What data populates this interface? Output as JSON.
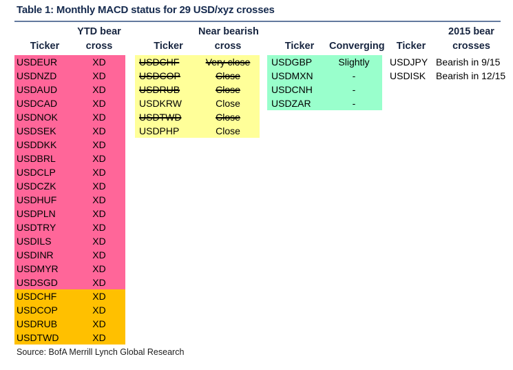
{
  "title": "Table 1: Monthly MACD status for 29 USD/xyz crosses",
  "source": "Source: BofA Merrill Lynch Global Research",
  "colors": {
    "pink": "#ff6699",
    "orange": "#ffc000",
    "yellow": "#ffff99",
    "green": "#99ffcc",
    "title_text": "#152a4e",
    "rule": "#63799e"
  },
  "columns": [
    {
      "id": "ytd-bear-cross",
      "header_line1": "YTD bear",
      "header_line2": "cross",
      "ticker_header": "Ticker",
      "rows": [
        {
          "ticker": "USDEUR",
          "value": "XD",
          "fill": "pink",
          "strike": false
        },
        {
          "ticker": "USDNZD",
          "value": "XD",
          "fill": "pink",
          "strike": false
        },
        {
          "ticker": "USDAUD",
          "value": "XD",
          "fill": "pink",
          "strike": false
        },
        {
          "ticker": "USDCAD",
          "value": "XD",
          "fill": "pink",
          "strike": false
        },
        {
          "ticker": "USDNOK",
          "value": "XD",
          "fill": "pink",
          "strike": false
        },
        {
          "ticker": "USDSEK",
          "value": "XD",
          "fill": "pink",
          "strike": false
        },
        {
          "ticker": "USDDKK",
          "value": "XD",
          "fill": "pink",
          "strike": false
        },
        {
          "ticker": "USDBRL",
          "value": "XD",
          "fill": "pink",
          "strike": false
        },
        {
          "ticker": "USDCLP",
          "value": "XD",
          "fill": "pink",
          "strike": false
        },
        {
          "ticker": "USDCZK",
          "value": "XD",
          "fill": "pink",
          "strike": false
        },
        {
          "ticker": "USDHUF",
          "value": "XD",
          "fill": "pink",
          "strike": false
        },
        {
          "ticker": "USDPLN",
          "value": "XD",
          "fill": "pink",
          "strike": false
        },
        {
          "ticker": "USDTRY",
          "value": "XD",
          "fill": "pink",
          "strike": false
        },
        {
          "ticker": "USDILS",
          "value": "XD",
          "fill": "pink",
          "strike": false
        },
        {
          "ticker": "USDINR",
          "value": "XD",
          "fill": "pink",
          "strike": false
        },
        {
          "ticker": "USDMYR",
          "value": "XD",
          "fill": "pink",
          "strike": false
        },
        {
          "ticker": "USDSGD",
          "value": "XD",
          "fill": "pink",
          "strike": false
        },
        {
          "ticker": "USDCHF",
          "value": "XD",
          "fill": "orange",
          "strike": false
        },
        {
          "ticker": "USDCOP",
          "value": "XD",
          "fill": "orange",
          "strike": false
        },
        {
          "ticker": "USDRUB",
          "value": "XD",
          "fill": "orange",
          "strike": false
        },
        {
          "ticker": "USDTWD",
          "value": "XD",
          "fill": "orange",
          "strike": false
        }
      ]
    },
    {
      "id": "near-bearish-cross",
      "header_line1": "Near bearish",
      "header_line2": "cross",
      "ticker_header": "Ticker",
      "rows": [
        {
          "ticker": "USDCHF",
          "value": "Very close",
          "fill": "yellow",
          "strike": true
        },
        {
          "ticker": "USDCOP",
          "value": "Close",
          "fill": "yellow",
          "strike": true
        },
        {
          "ticker": "USDRUB",
          "value": "Close",
          "fill": "yellow",
          "strike": true
        },
        {
          "ticker": "USDKRW",
          "value": "Close",
          "fill": "yellow",
          "strike": false
        },
        {
          "ticker": "USDTWD",
          "value": "Close",
          "fill": "yellow",
          "strike": true
        },
        {
          "ticker": "USDPHP",
          "value": "Close",
          "fill": "yellow",
          "strike": false
        }
      ]
    },
    {
      "id": "converging",
      "header_line1": "",
      "header_line2": "Converging",
      "ticker_header": "Ticker",
      "rows": [
        {
          "ticker": "USDGBP",
          "value": "Slightly",
          "fill": "green",
          "strike": false
        },
        {
          "ticker": "USDMXN",
          "value": "-",
          "fill": "green",
          "strike": false
        },
        {
          "ticker": "USDCNH",
          "value": "-",
          "fill": "green",
          "strike": false
        },
        {
          "ticker": "USDZAR",
          "value": "-",
          "fill": "green",
          "strike": false
        }
      ]
    },
    {
      "id": "2015-bear-crosses",
      "header_line1": "2015 bear",
      "header_line2": "crosses",
      "ticker_header": "Ticker",
      "rows": [
        {
          "ticker": "USDJPY",
          "value": "Bearish in 9/15",
          "fill": "none",
          "strike": false
        },
        {
          "ticker": "USDISK",
          "value": "Bearish in 12/15",
          "fill": "none",
          "strike": false
        }
      ]
    }
  ]
}
